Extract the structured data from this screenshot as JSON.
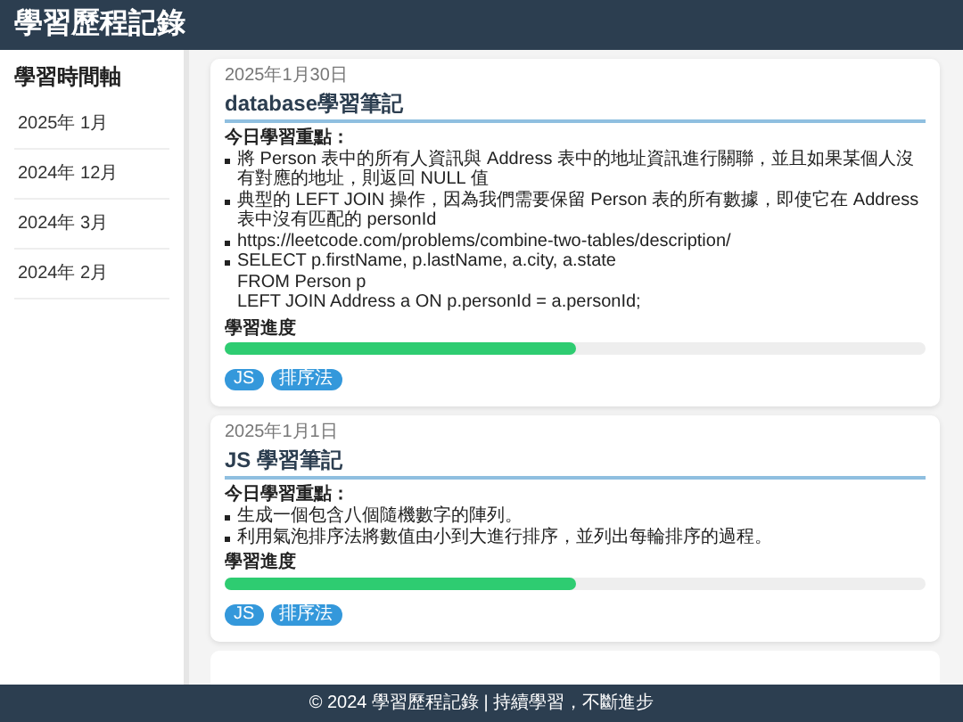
{
  "header": {
    "title": "學習歷程記錄"
  },
  "sidebar": {
    "title": "學習時間軸",
    "items": [
      "2025年 1月",
      "2024年 12月",
      "2024年 3月",
      "2024年 2月"
    ]
  },
  "entries": [
    {
      "date": "2025年1月30日",
      "title": "database學習筆記",
      "points_heading": "今日學習重點：",
      "points": [
        "將 Person 表中的所有人資訊與 Address 表中的地址資訊進行關聯，並且如果某個人沒有對應的地址，則返回 NULL 值",
        "典型的 LEFT JOIN 操作，因為我們需要保留 Person 表的所有數據，即使它在 Address 表中沒有匹配的 personId",
        "https://leetcode.com/problems/combine-two-tables/description/",
        "SELECT p.firstName, p.lastName, a.city, a.state\nFROM Person p\nLEFT JOIN Address a ON p.personId = a.personId;"
      ],
      "progress_label": "學習進度",
      "level": 0.5,
      "tags": [
        "JS",
        "排序法"
      ]
    },
    {
      "date": "2025年1月1日",
      "title": "JS 學習筆記",
      "points_heading": "今日學習重點：",
      "points": [
        "生成一個包含八個隨機數字的陣列。",
        "利用氣泡排序法將數值由小到大進行排序，並列出每輪排序的過程。"
      ],
      "progress_label": "學習進度",
      "level": 0.5,
      "tags": [
        "JS",
        "排序法"
      ]
    }
  ],
  "footer": "© 2024 學習歷程記錄 | 持續學習，不斷進步"
}
